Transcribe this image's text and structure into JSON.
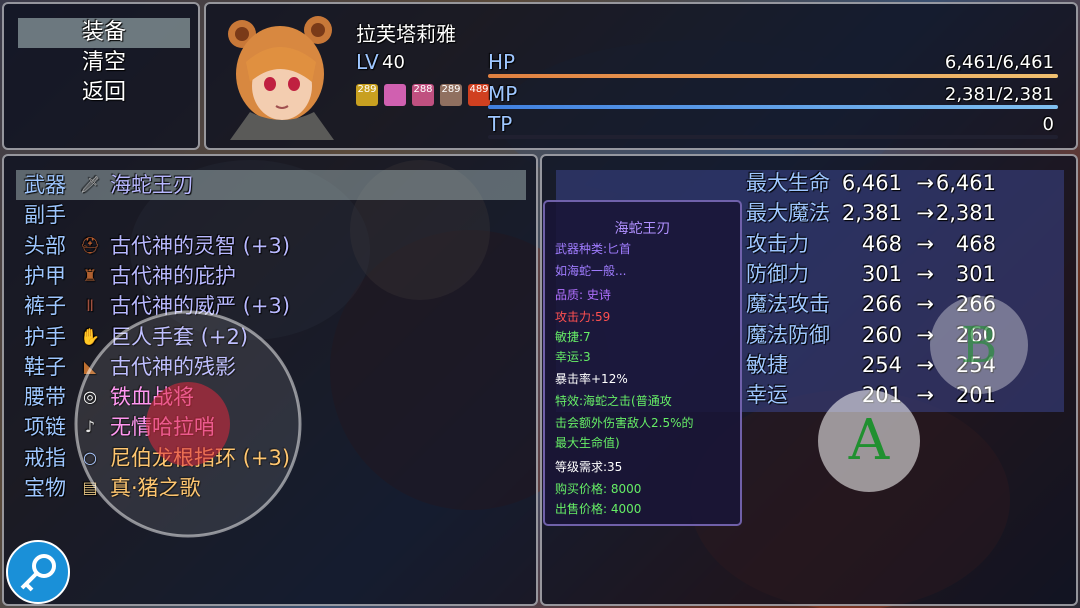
{
  "menu": {
    "items": [
      "装备",
      "清空",
      "返回"
    ]
  },
  "actor": {
    "name": "拉芙塔莉雅",
    "level_prefix": "LV",
    "level": "40",
    "hp_label": "HP",
    "hp_value": "6,461/6,461",
    "hp_ratio": 1.0,
    "mp_label": "MP",
    "mp_value": "2,381/2,381",
    "mp_ratio": 1.0,
    "tp_label": "TP",
    "tp_value": "0",
    "tp_ratio": 0.0,
    "states": [
      "289",
      "",
      "288",
      "289",
      "489"
    ]
  },
  "slots": [
    {
      "label": "武器",
      "icon": "sword-icon",
      "name": "海蛇王刃",
      "color": "#b8b8ff"
    },
    {
      "label": "副手",
      "icon": "",
      "name": "",
      "color": "#ffffff"
    },
    {
      "label": "头部",
      "icon": "helmet-icon",
      "name": "古代神的灵智 (+3)",
      "color": "#b8b8ff"
    },
    {
      "label": "护甲",
      "icon": "armor-icon",
      "name": "古代神的庇护",
      "color": "#b8b8ff"
    },
    {
      "label": "裤子",
      "icon": "pants-icon",
      "name": "古代神的威严 (+3)",
      "color": "#b8b8ff"
    },
    {
      "label": "护手",
      "icon": "gauntlet-icon",
      "name": "巨人手套 (+2)",
      "color": "#b8b8ff"
    },
    {
      "label": "鞋子",
      "icon": "boots-icon",
      "name": "古代神的残影",
      "color": "#b8b8ff"
    },
    {
      "label": "腰带",
      "icon": "belt-icon",
      "name": "铁血战将",
      "color": "#ff8cf0"
    },
    {
      "label": "项链",
      "icon": "whistle-icon",
      "name": "无情哈拉哨",
      "color": "#ff8cf0"
    },
    {
      "label": "戒指",
      "icon": "ring-icon",
      "name": "尼伯龙根指环 (+3)",
      "color": "#ffc060"
    },
    {
      "label": "宝物",
      "icon": "scroll-icon",
      "name": "真·猪之歌",
      "color": "#ffc060"
    }
  ],
  "stats": [
    {
      "label": "最大生命",
      "cur": "6,461",
      "new": "6,461"
    },
    {
      "label": "最大魔法",
      "cur": "2,381",
      "new": "2,381"
    },
    {
      "label": "攻击力",
      "cur": "468",
      "new": "468"
    },
    {
      "label": "防御力",
      "cur": "301",
      "new": "301"
    },
    {
      "label": "魔法攻击",
      "cur": "266",
      "new": "266"
    },
    {
      "label": "魔法防御",
      "cur": "260",
      "new": "260"
    },
    {
      "label": "敏捷",
      "cur": "254",
      "new": "254"
    },
    {
      "label": "幸运",
      "cur": "201",
      "new": "201"
    }
  ],
  "arrow": "→",
  "item_info": {
    "title": "海蛇王刃",
    "lines": [
      {
        "text": "武器种类:匕首",
        "color": "#a07cff"
      },
      {
        "text": "如海蛇一般...",
        "color": "#a07cff"
      },
      {
        "text": "品质: 史诗",
        "color": "#b070ff"
      },
      {
        "text": "攻击力:59",
        "color": "#ff5050"
      },
      {
        "text": "敏捷:7",
        "color": "#66ee66"
      },
      {
        "text": "幸运:3",
        "color": "#66ee66"
      },
      {
        "text": "暴击率+12%",
        "color": "#ffffff"
      },
      {
        "text": "特效:海蛇之击(普通攻",
        "color": "#66ee66"
      },
      {
        "text": "击会额外伤害敌人2.5%的",
        "color": "#66ee66"
      },
      {
        "text": "最大生命值)",
        "color": "#66ee66"
      },
      {
        "text": "等级需求:35",
        "color": "#ffffff"
      },
      {
        "text": "购买价格: 8000",
        "color": "#66ee66"
      },
      {
        "text": "出售价格: 4000",
        "color": "#66ee66"
      }
    ]
  },
  "touch": {
    "a_label": "A",
    "b_label": "B"
  }
}
